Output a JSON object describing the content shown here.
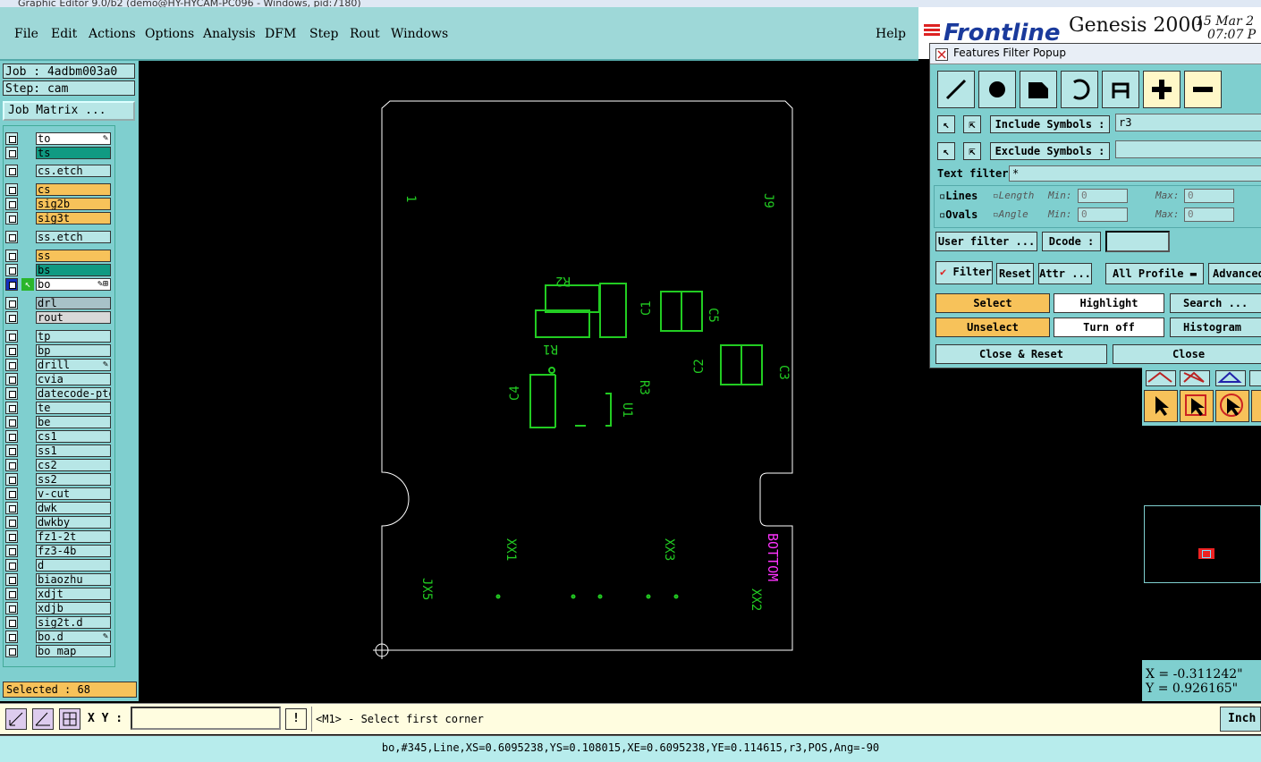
{
  "window": {
    "title": "Graphic Editor 9.0/b2 (demo@HY-HYCAM-PC096 - Windows, pid:7180)"
  },
  "menu": {
    "file": "File",
    "edit": "Edit",
    "actions": "Actions",
    "options": "Options",
    "analysis": "Analysis",
    "dfm": "DFM",
    "step": "Step",
    "rout": "Rout",
    "windows": "Windows",
    "help": "Help"
  },
  "brand": {
    "logo": "Frontline",
    "product": "Genesis 2000",
    "date": "15 Mar 2",
    "time": "07:07 P"
  },
  "job": {
    "job_label": "Job : 4adbm003a0",
    "step_label": "Step: cam",
    "matrix_button": "Job Matrix ..."
  },
  "layers": [
    {
      "name": "to",
      "bg": "#ffffff",
      "mark": "brush"
    },
    {
      "name": "ts",
      "bg": "#109a82"
    },
    {
      "name": "cs.etch",
      "bg": "#b7e6e6"
    },
    {
      "name": "cs",
      "bg": "#f7c25a"
    },
    {
      "name": "sig2b",
      "bg": "#f7c25a"
    },
    {
      "name": "sig3t",
      "bg": "#f7c25a"
    },
    {
      "name": "ss.etch",
      "bg": "#b7e6e6"
    },
    {
      "name": "ss",
      "bg": "#f7c25a"
    },
    {
      "name": "bs",
      "bg": "#109a82"
    },
    {
      "name": "bo",
      "bg": "#ffffff",
      "mark": "brush-grid",
      "active": true
    },
    {
      "name": "drl",
      "bg": "#a8c2c8"
    },
    {
      "name": "rout",
      "bg": "#d8d8d8"
    },
    {
      "name": "tp",
      "bg": "#b7e6e6"
    },
    {
      "name": "bp",
      "bg": "#b7e6e6"
    },
    {
      "name": "drill",
      "bg": "#b7e6e6",
      "mark": "brush"
    },
    {
      "name": "cvia",
      "bg": "#b7e6e6"
    },
    {
      "name": "datecode-pte",
      "bg": "#b7e6e6"
    },
    {
      "name": "te",
      "bg": "#b7e6e6"
    },
    {
      "name": "be",
      "bg": "#b7e6e6"
    },
    {
      "name": "cs1",
      "bg": "#b7e6e6"
    },
    {
      "name": "ss1",
      "bg": "#b7e6e6"
    },
    {
      "name": "cs2",
      "bg": "#b7e6e6"
    },
    {
      "name": "ss2",
      "bg": "#b7e6e6"
    },
    {
      "name": "v-cut",
      "bg": "#b7e6e6"
    },
    {
      "name": "dwk",
      "bg": "#b7e6e6"
    },
    {
      "name": "dwkby",
      "bg": "#b7e6e6"
    },
    {
      "name": "fz1-2t",
      "bg": "#b7e6e6"
    },
    {
      "name": "fz3-4b",
      "bg": "#b7e6e6"
    },
    {
      "name": "d",
      "bg": "#b7e6e6"
    },
    {
      "name": "biaozhu",
      "bg": "#b7e6e6"
    },
    {
      "name": "xdjt",
      "bg": "#b7e6e6"
    },
    {
      "name": "xdjb",
      "bg": "#b7e6e6"
    },
    {
      "name": "sig2t.d",
      "bg": "#b7e6e6"
    },
    {
      "name": "bo.d",
      "bg": "#b7e6e6",
      "mark": "brush"
    },
    {
      "name": "bo_map",
      "bg": "#b7e6e6"
    }
  ],
  "selected": {
    "label": "Selected : 68"
  },
  "board": {
    "labels": [
      "1",
      "J9",
      "R2",
      "R1",
      "C1",
      "C5",
      "R3",
      "C2",
      "C3",
      "C4",
      "U1",
      "XX1",
      "XX3",
      "JX5",
      "XX2"
    ],
    "bottom_label": "BOTTOM",
    "outline_color": "#ffffff",
    "silk_color": "#22cc22",
    "magenta": "#ff33ff"
  },
  "filter_popup": {
    "title": "Features Filter Popup",
    "include_symbols_btn": "Include Symbols :",
    "include_symbols_value": "r3",
    "exclude_symbols_btn": "Exclude Symbols :",
    "exclude_symbols_value": "",
    "text_filter_label": "Text filter",
    "text_filter_value": "*",
    "lines_label": "Lines",
    "ovals_label": "Ovals",
    "length_label": "Length",
    "angle_label": "Angle",
    "min_label": "Min:",
    "max_label": "Max:",
    "min_length": "0",
    "max_length": "0",
    "min_angle": "0",
    "max_angle": "0",
    "user_filter_btn": "User filter ...",
    "dcode_btn": "Dcode :",
    "dcode_value": "",
    "filter_toggle": "Filter",
    "reset_btn": "Reset",
    "attr_btn": "Attr ...",
    "profile_select": "All Profile",
    "advanced_btn": "Advanced",
    "select_btn": "Select",
    "highlight_btn": "Highlight",
    "search_btn": "Search ...",
    "unselect_btn": "Unselect",
    "turnoff_btn": "Turn off",
    "histogram_btn": "Histogram ...",
    "close_reset_btn": "Close & Reset",
    "close_btn": "Close"
  },
  "coords": {
    "x": "X = -0.311242\"",
    "y": "Y = 0.926165\""
  },
  "command": {
    "xy_label": "X Y :",
    "xy_value": "",
    "prompt": "<M1> - Select first corner",
    "units": "Inch"
  },
  "status": {
    "text": "bo,#345,Line,XS=0.6095238,YS=0.108015,XE=0.6095238,YE=0.114615,r3,POS,Ang=-90"
  }
}
